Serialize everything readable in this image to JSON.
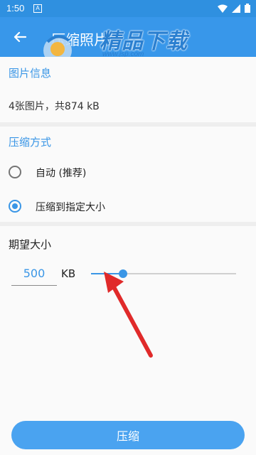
{
  "status_bar": {
    "time": "1:50",
    "notif_letter": "A"
  },
  "app_bar": {
    "title": "压缩照片"
  },
  "watermark": {
    "text": "精品下载",
    "url": "www.jsp.com"
  },
  "image_info": {
    "title": "图片信息",
    "summary": "4张图片，共874 kB"
  },
  "compress_method": {
    "title": "压缩方式",
    "options": [
      {
        "label": "自动 (推荐)",
        "selected": false
      },
      {
        "label": "压缩到指定大小",
        "selected": true
      }
    ]
  },
  "expected_size": {
    "title": "期望大小",
    "value": "500",
    "unit": "KB",
    "slider_fraction": 0.22
  },
  "bottom": {
    "compress_label": "压缩"
  },
  "colors": {
    "primary": "#3897ea",
    "accent": "#3a96e6",
    "annotation_arrow": "#e02a2a"
  }
}
